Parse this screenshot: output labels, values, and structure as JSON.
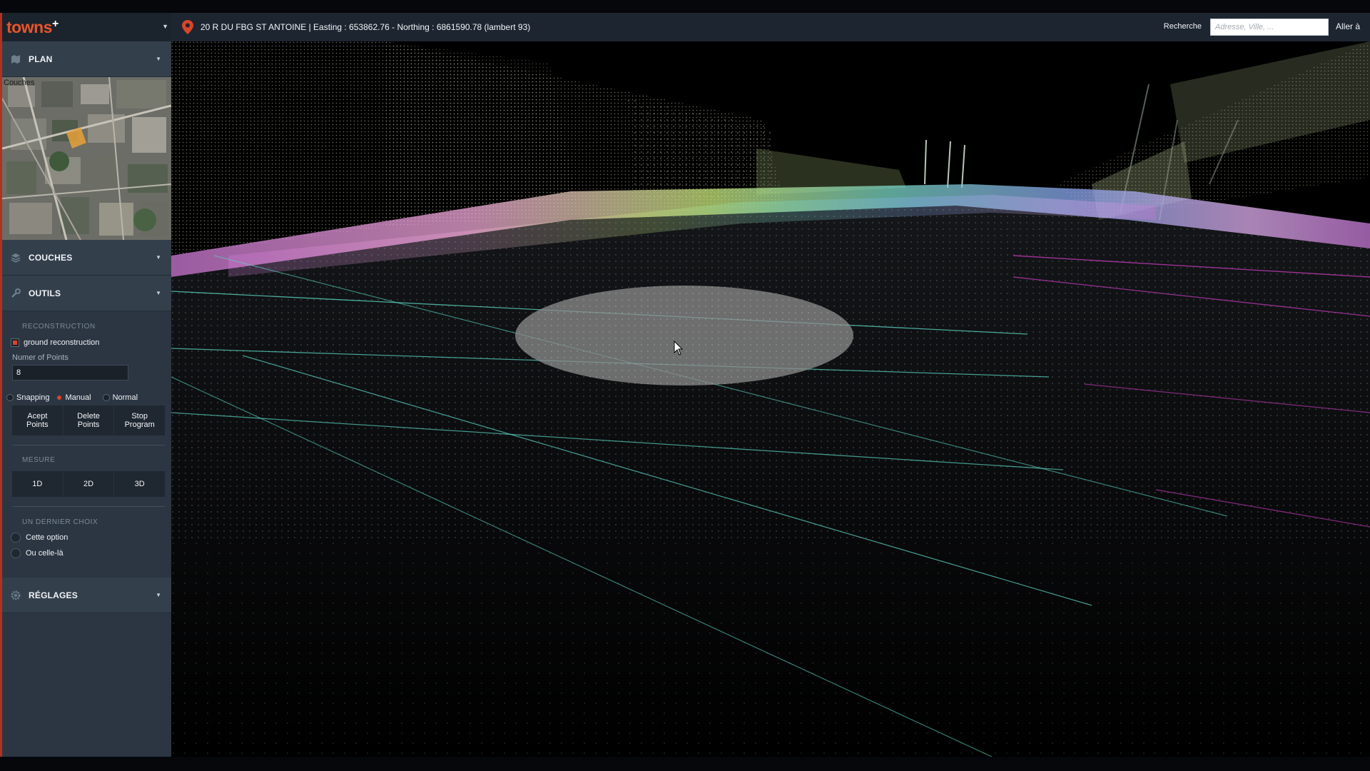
{
  "app": {
    "logo_text": "towns",
    "logo_plus": "+"
  },
  "header": {
    "address": "20 R DU FBG ST ANTOINE | Easting : 653862.76 - Northing : 6861590.78 (lambert 93)",
    "search_label": "Recherche",
    "search_placeholder": "Adresse, Ville, ...",
    "goto_label": "Aller à"
  },
  "sidebar": {
    "plan": {
      "label": "PLAN",
      "map_label": "Couches"
    },
    "couches": {
      "label": "COUCHES"
    },
    "outils": {
      "label": "OUTILS",
      "reconstruction": {
        "heading": "RECONSTRUCTION",
        "checkbox_label": "ground reconstruction",
        "points_label": "Numer of Points",
        "points_value": "8",
        "snapping_label": "Snapping",
        "manual_label": "Manual",
        "normal_label": "Normal",
        "buttons": [
          "Acept\nPoints",
          "Delete\nPoints",
          "Stop\nProgram"
        ]
      },
      "mesure": {
        "heading": "MESURE",
        "buttons": [
          "1D",
          "2D",
          "3D"
        ]
      },
      "dernier_choix": {
        "heading": "UN DERNIER CHOIX",
        "options": [
          "Cette option",
          "Ou celle-là"
        ]
      }
    },
    "reglages": {
      "label": "RÉGLAGES"
    }
  },
  "colors": {
    "accent": "#d9452a",
    "sidebar_bg": "#2c3643",
    "header_bg": "#1d2530",
    "brand": "#e8552b"
  },
  "icons": {
    "plan": "map-icon",
    "couches": "layers-icon",
    "outils": "wrench-icon",
    "reglages": "gear-icon",
    "location": "map-pin-icon"
  }
}
